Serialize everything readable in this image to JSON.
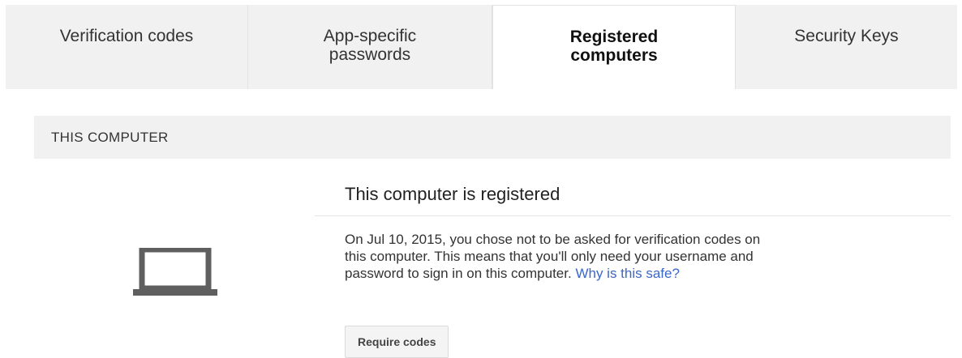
{
  "tabs": [
    {
      "label": "Verification codes",
      "active": false
    },
    {
      "label": "App-specific\npasswords",
      "active": false
    },
    {
      "label": "Registered\ncomputers",
      "active": true
    },
    {
      "label": "Security Keys",
      "active": false
    }
  ],
  "section": {
    "header": "THIS COMPUTER"
  },
  "status": {
    "heading": "This computer is registered",
    "description": "On Jul 10, 2015, you chose not to be asked for verification codes on\nthis computer. This means that you'll only need your username and\npassword to sign in on this computer. ",
    "link_text": "Why is this safe?"
  },
  "actions": {
    "require_codes_label": "Require codes"
  },
  "icons": {
    "device": "laptop-icon"
  },
  "colors": {
    "tab_bg": "#f1f1f1",
    "active_tab_bg": "#ffffff",
    "link": "#3b67c8",
    "icon": "#5f5f5f"
  }
}
